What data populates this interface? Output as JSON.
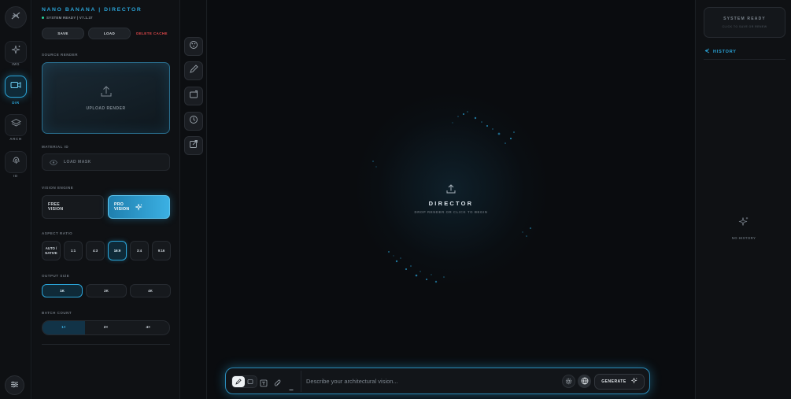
{
  "rail": {
    "items": [
      {
        "label": "IMG",
        "icon": "sparkles-icon"
      },
      {
        "label": "DIR",
        "icon": "video-icon"
      },
      {
        "label": "ARCH",
        "icon": "layers-icon"
      },
      {
        "label": "ID",
        "icon": "fingerprint-icon"
      }
    ],
    "active_label": "DIR"
  },
  "panel": {
    "brand": "NANO BANANA | DIRECTOR",
    "status": "SYSTEM READY | V7.1.37",
    "save_label": "SAVE",
    "load_label": "LOAD",
    "delete_label": "DELETE CACHE",
    "source_title": "SOURCE RENDER",
    "upload_label": "UPLOAD RENDER",
    "material_title": "MATERIAL ID",
    "mask_label": "LOAD MASK",
    "vision_title": "VISION ENGINE",
    "vision_free_1": "FREE",
    "vision_free_2": "VISION",
    "vision_pro_1": "PRO",
    "vision_pro_2": "VISION",
    "aspect_title": "ASPECT RATIO",
    "aspect_auto_1": "AUTO /",
    "aspect_auto_2": "NATIVE",
    "aspect_ratios": [
      "1:1",
      "4:3",
      "16:9",
      "3:4",
      "9:16"
    ],
    "aspect_selected": "16:9",
    "output_title": "OUTPUT SIZE",
    "output_sizes": [
      "1K",
      "2K",
      "4K"
    ],
    "output_selected": "1K",
    "batch_title": "BATCH COUNT",
    "batch_counts": [
      "1×",
      "2×",
      "4×"
    ],
    "batch_selected": "1×"
  },
  "canvas": {
    "title": "DIRECTOR",
    "subtitle": "DROP RENDER OR CLICK TO BEGIN"
  },
  "prompt": {
    "placeholder": "Describe your architectural vision...",
    "generate_label": "GENERATE"
  },
  "history": {
    "system_title": "SYSTEM READY",
    "system_sub": "CLICK TO SAVE OR RENEW",
    "title": "HISTORY",
    "empty_label": "NO HISTORY"
  },
  "colors": {
    "accent": "#2aa3d6",
    "danger": "#e0484a",
    "ready": "#2ad39a",
    "background": "#0b0d10"
  }
}
